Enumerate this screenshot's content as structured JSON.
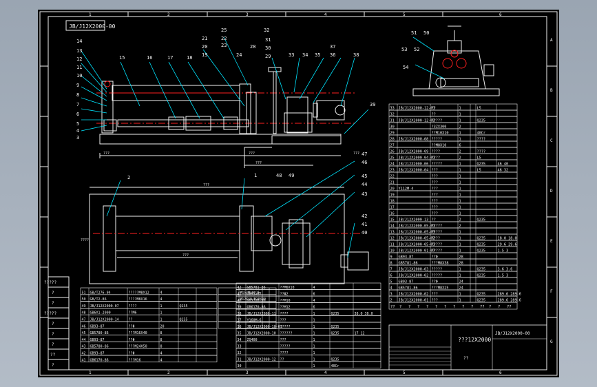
{
  "drawing": {
    "number_stamp": "JB/J12X2000-00",
    "title": "???12X2000",
    "title_sub": "??",
    "title_code": "JB/J12X2000-00",
    "stamp_cells": [
      "?????",
      "?",
      "?",
      "?????",
      "?",
      "?",
      "?",
      "??",
      "?"
    ],
    "zone_letters": [
      "A",
      "B",
      "C",
      "D",
      "E",
      "F",
      "G"
    ],
    "zone_numbers": [
      "1",
      "2",
      "3",
      "4",
      "5",
      "6"
    ]
  },
  "balloons_top": [
    "25",
    "32",
    "22",
    "23",
    "24",
    "21",
    "28",
    "31",
    "20",
    "30",
    "19",
    "29",
    "33",
    "34",
    "35",
    "37",
    "36",
    "38"
  ],
  "balloons_left": [
    "14",
    "13",
    "12",
    "11",
    "10",
    "9",
    "8",
    "7",
    "6",
    "5",
    "4",
    "3"
  ],
  "balloons_mid": [
    "15",
    "16",
    "17",
    "18"
  ],
  "balloons_right_view": [
    "51",
    "50",
    "53",
    "52",
    "54"
  ],
  "balloons_plan": [
    "2",
    "1",
    "48",
    "49",
    "47",
    "46",
    "45",
    "44",
    "43",
    "42",
    "41",
    "40",
    "39"
  ],
  "dims": [
    "???",
    "???",
    "???",
    "???",
    "???",
    "???",
    "????"
  ],
  "bom_right": [
    [
      "33",
      "JB/J12X2000-12-01",
      "??",
      "1",
      "",
      "L5",
      ""
    ],
    [
      "32",
      "",
      "??",
      "1",
      "",
      "",
      ""
    ],
    [
      "31",
      "JB/J12X2000-12-02",
      "?????",
      "1",
      "",
      "Q235",
      ""
    ],
    [
      "30",
      "",
      "?3ZX300",
      "2",
      "",
      "",
      ""
    ],
    [
      "29",
      "",
      "??M10X10",
      "1",
      "",
      "40Cr",
      ""
    ],
    [
      "28",
      "JB/J12X2000-08",
      "?????",
      "1",
      "",
      "????",
      ""
    ],
    [
      "27",
      "",
      "??M8X10",
      "6",
      "",
      "",
      ""
    ],
    [
      "26",
      "JB/J12X2000-09",
      "????",
      "2",
      "",
      "????",
      ""
    ],
    [
      "25",
      "JB/J12X2000-04-01",
      "????",
      "2",
      "",
      "L5",
      ""
    ],
    [
      "24",
      "JB/J12X2000-06",
      "?????",
      "1",
      "",
      "Q235",
      "46  40"
    ],
    [
      "23",
      "JB/J12X2000-04",
      "???",
      "1",
      "",
      "L5",
      "46  32"
    ],
    [
      "22",
      "",
      "???",
      "1",
      "",
      "",
      ""
    ],
    [
      "21",
      "",
      "???",
      "1",
      "",
      "",
      ""
    ],
    [
      "20",
      "Y112M-4",
      "???",
      "1",
      "",
      "",
      ""
    ],
    [
      "19",
      "",
      "???",
      "1",
      "",
      "",
      ""
    ],
    [
      "18",
      "",
      "???",
      "1",
      "",
      "",
      ""
    ],
    [
      "17",
      "",
      "???",
      "1",
      "",
      "",
      ""
    ],
    [
      "16",
      "",
      "???",
      "1",
      "",
      "",
      ""
    ],
    [
      "15",
      "JB/J12X2000-13",
      "??",
      "2",
      "",
      "Q235",
      ""
    ],
    [
      "14",
      "JB/J12X2000-05-01",
      "?????",
      "2",
      "",
      "",
      ""
    ],
    [
      "13",
      "JB/J12X2000-05-03",
      "?????",
      "1",
      "",
      "",
      ""
    ],
    [
      "12",
      "JB/J12X2000-05-02",
      "????",
      "1",
      "",
      "Q235",
      "18.0 18.0"
    ],
    [
      "11",
      "JB/J12X2000-05-01",
      "?????",
      "1",
      "",
      "Q235",
      "29.6 29.6"
    ],
    [
      "10",
      "JB/J12X2000-01-07",
      "?????",
      "1",
      "",
      "Q235",
      "1.5  3"
    ],
    [
      "9",
      "GB93-87",
      "??Φ",
      "28",
      "",
      "",
      ""
    ],
    [
      "8",
      "GB5781-86",
      "???M8X38",
      "28",
      "",
      "",
      ""
    ],
    [
      "7",
      "JB/J12X2000-03",
      "?????",
      "1",
      "",
      "Q235",
      "3.6  3.6"
    ],
    [
      "6",
      "JB/J12X2000-02",
      "?????",
      "1",
      "",
      "Q235",
      "1.5  3"
    ],
    [
      "5",
      "GB93-87",
      "??Φ",
      "24",
      "",
      "",
      ""
    ],
    [
      "4",
      "GB5781-86",
      "???M8X25",
      "24",
      "",
      "",
      ""
    ],
    [
      "3",
      "JB/J12X2000-02",
      "???",
      "1",
      "",
      "Q235",
      "289.6 289.6"
    ],
    [
      "2",
      "JB/J12X2000-01",
      "???",
      "1",
      "",
      "Q235",
      "289.6 289.6"
    ]
  ],
  "bom_right_header": [
    "??",
    "?",
    "?",
    "?",
    "?",
    "?",
    "?",
    "?",
    "?",
    "?",
    "??",
    "?",
    "?",
    "??"
  ],
  "bom_bottom_left": [
    [
      "51",
      "GB/T276-94",
      "?????M8X12",
      "4",
      "",
      ""
    ],
    [
      "50",
      "GB/T2-86",
      "????M8X16",
      "4",
      "",
      ""
    ],
    [
      "49",
      "JB/J12X2000-07",
      "????",
      "1",
      "Q235",
      ""
    ],
    [
      "48",
      "GB6X1-2000",
      "??M6",
      "1",
      "",
      ""
    ],
    [
      "47",
      "JB/J12X2000-14",
      "??",
      "1",
      "Q235",
      ""
    ],
    [
      "46",
      "GB93-87",
      "??Φ",
      "20",
      "",
      ""
    ],
    [
      "45",
      "GB5780-86",
      "???M16X40",
      "8",
      "",
      ""
    ],
    [
      "44",
      "GB93-87",
      "??Φ",
      "8",
      "",
      ""
    ],
    [
      "43",
      "GB5780-86",
      "???M24X50",
      "8",
      "",
      ""
    ],
    [
      "42",
      "GB93-87",
      "??Φ",
      "4",
      "",
      ""
    ],
    [
      "41",
      "GB6170-86",
      "???M16",
      "4",
      "",
      ""
    ]
  ],
  "bom_bottom_mid": [
    [
      "",
      "M15/M10X25",
      "",
      ""
    ],
    [
      "",
      "M12X40/M10X30",
      "",
      ""
    ],
    [
      "",
      "",
      "",
      ""
    ],
    [
      "",
      "",
      "",
      ""
    ],
    [
      "",
      "",
      "",
      ""
    ],
    [
      "",
      "",
      "",
      ""
    ]
  ],
  "bom_bottom_right": [
    [
      "42",
      "GB5781-86",
      "??M6X10",
      "4",
      "",
      ""
    ],
    [
      "41",
      "GB93-87",
      "??Φ2",
      "6",
      "",
      ""
    ],
    [
      "40",
      "GB5780-86",
      "??M10",
      "4",
      "",
      ""
    ],
    [
      "39",
      "GB6170-86",
      "??M12",
      "6",
      "",
      ""
    ],
    [
      "38",
      "JB/J12X2000-11",
      "????",
      "1",
      "Q235",
      "38.0 38.0"
    ],
    [
      "37",
      "Y160M-6",
      "???",
      "1",
      "",
      ""
    ],
    [
      "36",
      "JB/J12X2000-10-01",
      "?????",
      "1",
      "Q235",
      ""
    ],
    [
      "35",
      "JB/J12X2000-10",
      "??????",
      "1",
      "Q235",
      "17   12"
    ],
    [
      "34",
      "ZQ400",
      "???",
      "1",
      "",
      ""
    ],
    [
      "33",
      "",
      "?????",
      "1",
      "",
      ""
    ],
    [
      "32",
      "",
      "????",
      "1",
      "",
      ""
    ],
    [
      "31",
      "JB/J12X2000-12",
      "??",
      "1",
      "Q235",
      ""
    ],
    [
      "30",
      "",
      "",
      "1",
      "40Cr",
      ""
    ]
  ]
}
